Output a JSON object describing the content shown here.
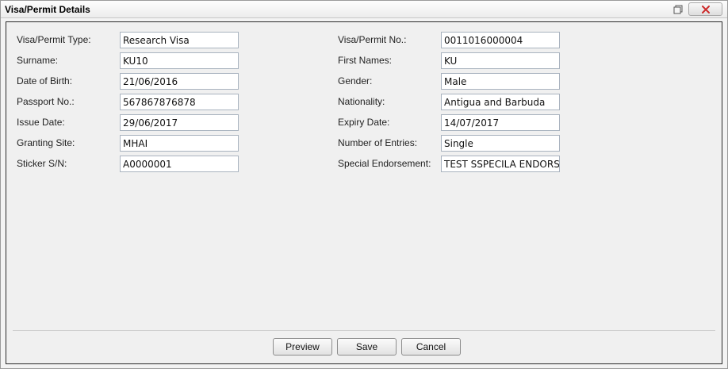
{
  "window": {
    "title": "Visa/Permit Details",
    "restore_icon": "restore-window-icon",
    "close_icon": "close-icon"
  },
  "left_fields": [
    {
      "label": "Visa/Permit Type:",
      "value": "Research Visa"
    },
    {
      "label": "Surname:",
      "value": "KU10"
    },
    {
      "label": "Date of Birth:",
      "value": "21/06/2016"
    },
    {
      "label": "Passport No.:",
      "value": "567867876878"
    },
    {
      "label": "Issue Date:",
      "value": "29/06/2017"
    },
    {
      "label": "Granting Site:",
      "value": "MHAI"
    },
    {
      "label": "Sticker S/N:",
      "value": "A0000001"
    }
  ],
  "right_fields": [
    {
      "label": "Visa/Permit No.:",
      "value": "0011016000004"
    },
    {
      "label": "First Names:",
      "value": "KU"
    },
    {
      "label": "Gender:",
      "value": "Male"
    },
    {
      "label": "Nationality:",
      "value": "Antigua and Barbuda"
    },
    {
      "label": "Expiry Date:",
      "value": "14/07/2017"
    },
    {
      "label": "Number of Entries:",
      "value": "Single"
    },
    {
      "label": "Special Endorsement:",
      "value": "TEST SSPECILA ENDORSEMENT"
    }
  ],
  "buttons": {
    "preview": "Preview",
    "save": "Save",
    "cancel": "Cancel"
  },
  "colors": {
    "panel_background": "#f0f0f0",
    "field_border": "#a9b3bf",
    "close_x": "#cc2a2a"
  }
}
